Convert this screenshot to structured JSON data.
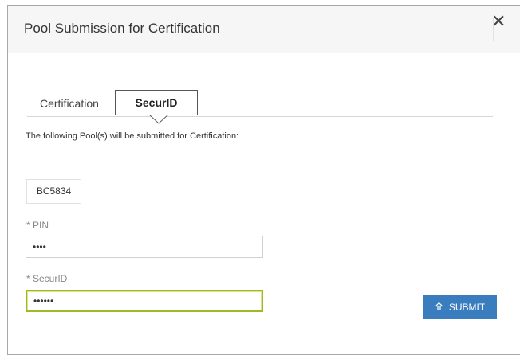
{
  "dialog": {
    "title": "Pool Submission for Certification",
    "close_glyph": "✕"
  },
  "tabs": [
    {
      "label": "Certification",
      "active": false
    },
    {
      "label": "SecurID",
      "active": true
    }
  ],
  "info_text": "The following Pool(s) will be submitted for Certification:",
  "pools": [
    "BC5834"
  ],
  "fields": {
    "pin": {
      "label": "* PIN",
      "value": "••••"
    },
    "securid": {
      "label": "* SecurID",
      "value": "••••••"
    }
  },
  "submit": {
    "label": "SUBMIT",
    "icon": "upload-arrow-icon"
  },
  "colors": {
    "accent": "#3a7dbf",
    "focus_border": "#9dbb26",
    "header_bg": "#f6f6f6"
  }
}
